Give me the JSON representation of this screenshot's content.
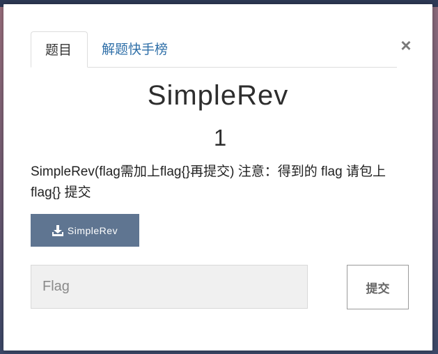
{
  "modal": {
    "tabs": [
      {
        "label": "题目",
        "active": true
      },
      {
        "label": "解题快手榜",
        "active": false
      }
    ],
    "close_symbol": "×",
    "challenge": {
      "name": "SimpleRev",
      "value": "1",
      "description": "SimpleRev(flag需加上flag{}再提交) 注意：得到的 flag 请包上 flag{} 提交"
    },
    "download": {
      "label": "SimpleRev",
      "icon": "download-icon"
    },
    "flag_field": {
      "placeholder": "Flag",
      "value": ""
    },
    "submit_label": "提交"
  },
  "colors": {
    "tab_link": "#2f6fa8",
    "download_button": "#5f7591",
    "input_background": "#f0f0f0"
  }
}
